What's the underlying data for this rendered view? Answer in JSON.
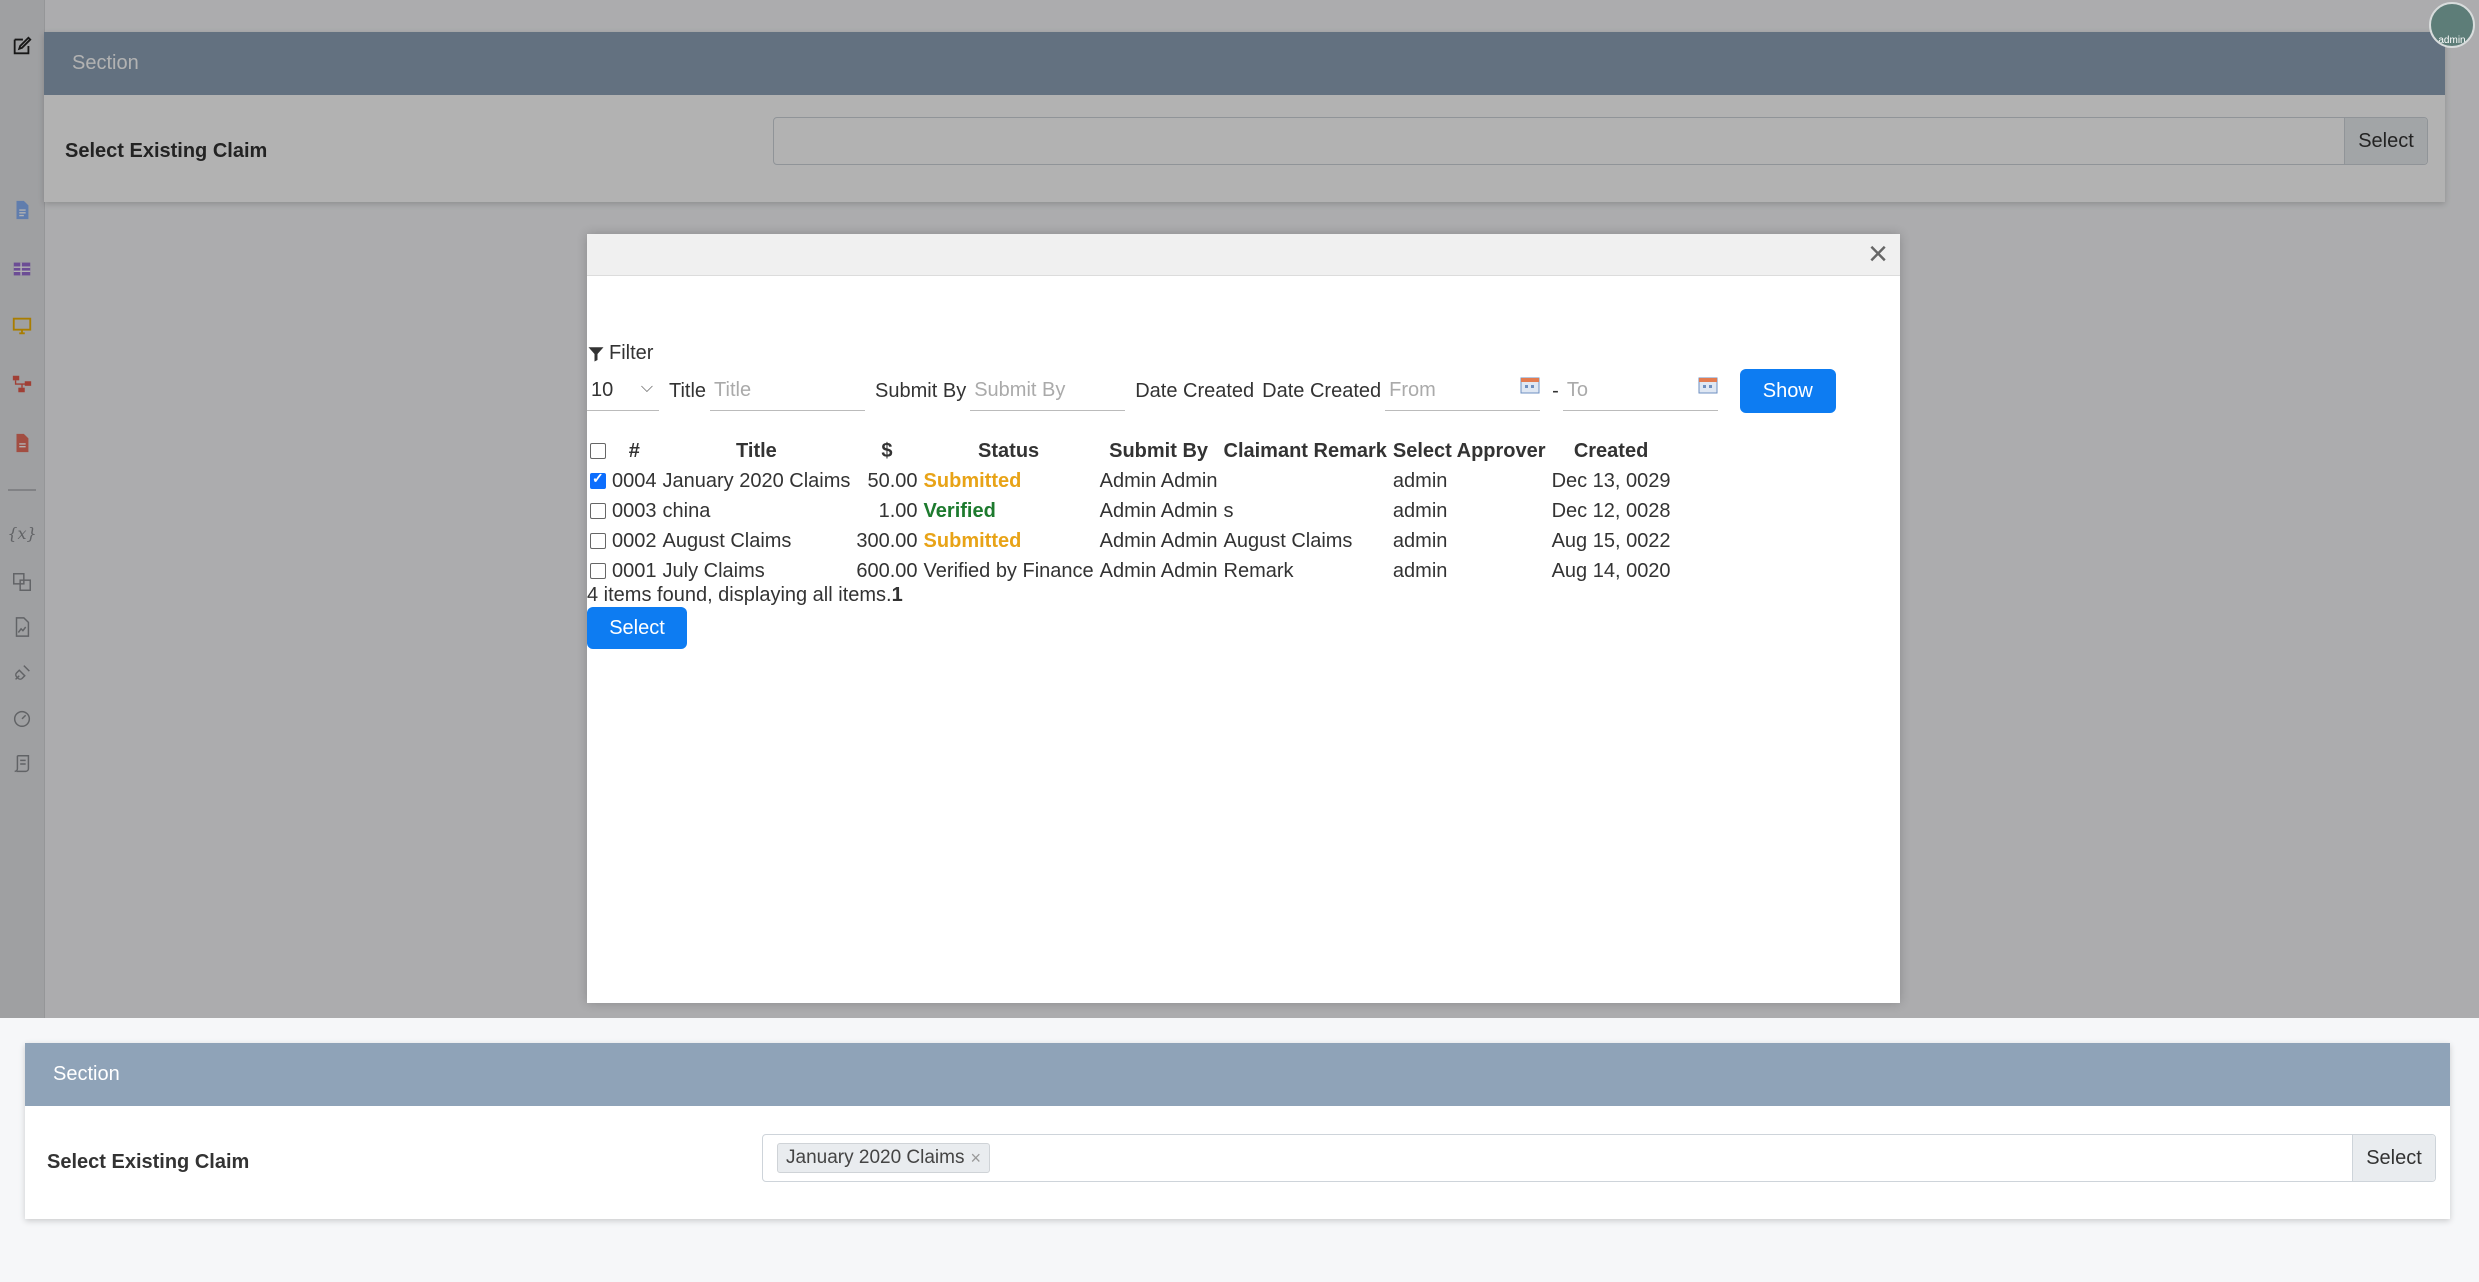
{
  "sections": {
    "top": {
      "header": "Section",
      "field_label": "Select Existing Claim",
      "select_label": "Select"
    },
    "bottom": {
      "header": "Section",
      "field_label": "Select Existing Claim",
      "select_label": "Select",
      "selected_chip": "January 2020 Claims"
    }
  },
  "avatar": {
    "label": "admin"
  },
  "modal": {
    "filter_label": "Filter",
    "page_size": "10",
    "filters": {
      "title_label": "Title",
      "title_placeholder": "Title",
      "submit_by_label": "Submit By",
      "submit_by_placeholder": "Submit By",
      "date_created_label_1": "Date Created",
      "date_created_label_2": "Date Created",
      "from_placeholder": "From",
      "range_separator": "-",
      "to_placeholder": "To",
      "show_button": "Show"
    },
    "table": {
      "headers": [
        "#",
        "Title",
        "$",
        "Status",
        "Submit By",
        "Claimant Remark",
        "Select Approver",
        "Created"
      ],
      "rows": [
        {
          "checked": true,
          "id": "0004",
          "title": "January 2020 Claims",
          "amount": "50.00",
          "status": "Submitted",
          "status_type": "submitted",
          "submit_by": "Admin Admin",
          "remark": "",
          "approver": "admin",
          "created": "Dec 13, 0029"
        },
        {
          "checked": false,
          "id": "0003",
          "title": "china",
          "amount": "1.00",
          "status": "Verified",
          "status_type": "verified",
          "submit_by": "Admin Admin",
          "remark": "s",
          "approver": "admin",
          "created": "Dec 12, 0028"
        },
        {
          "checked": false,
          "id": "0002",
          "title": "August Claims",
          "amount": "300.00",
          "status": "Submitted",
          "status_type": "submitted",
          "submit_by": "Admin Admin",
          "remark": "August Claims",
          "approver": "admin",
          "created": "Aug 15, 0022"
        },
        {
          "checked": false,
          "id": "0001",
          "title": "July Claims",
          "amount": "600.00",
          "status": "Verified by Finance",
          "status_type": "plain",
          "submit_by": "Admin Admin",
          "remark": "Remark",
          "approver": "admin",
          "created": "Aug 14, 0020"
        }
      ]
    },
    "summary_text": "4 items found, displaying all items.",
    "summary_page": "1",
    "select_button": "Select"
  },
  "colors": {
    "primary": "#0d7cf2",
    "section_header": "#8fa3b8",
    "submitted": "#e8a317",
    "verified": "#1d7a2e"
  }
}
